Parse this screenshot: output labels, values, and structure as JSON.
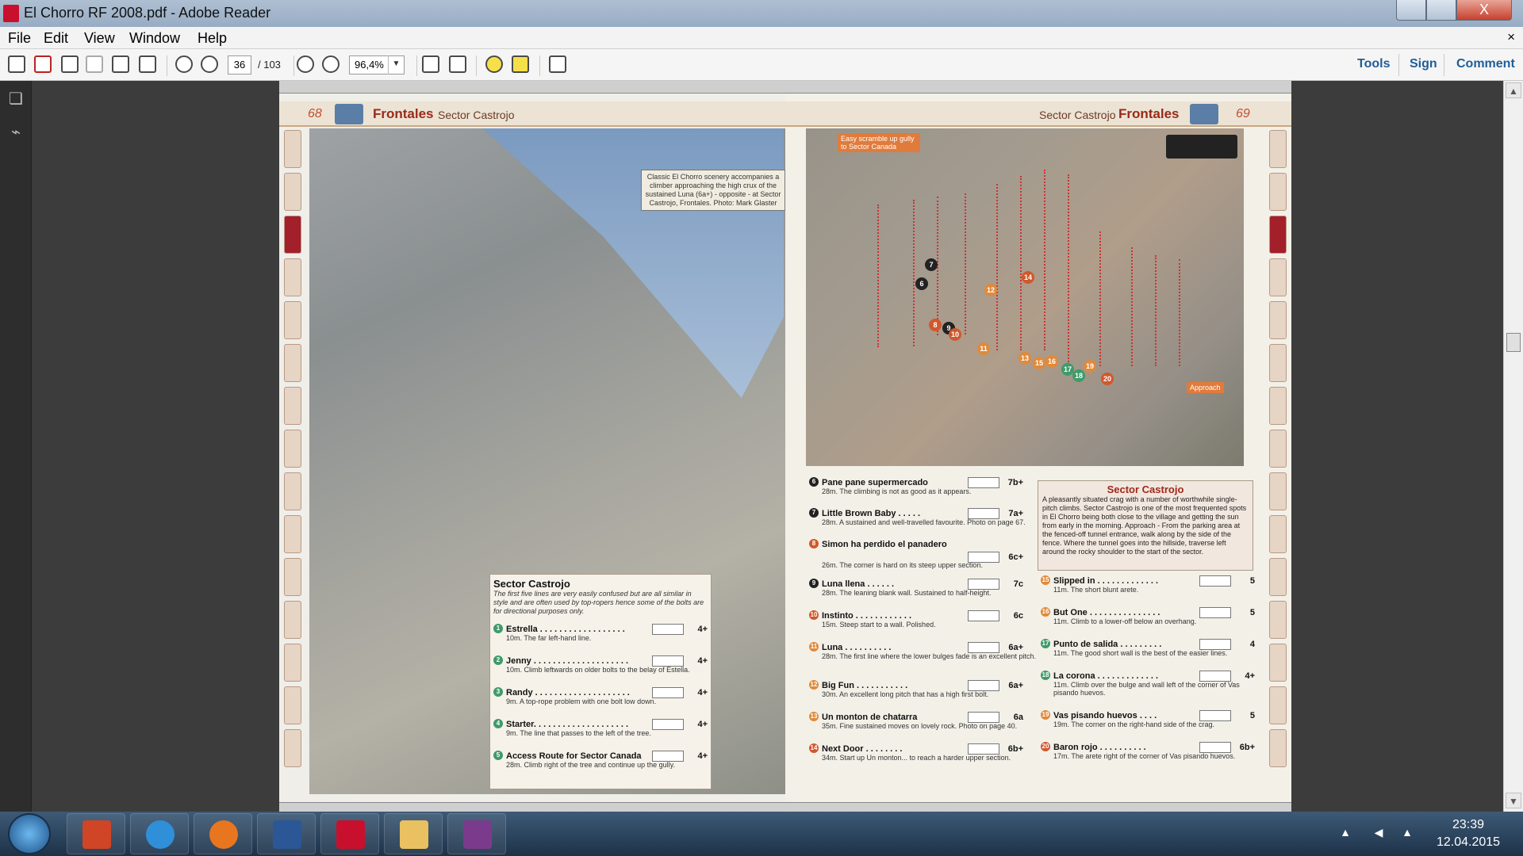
{
  "window": {
    "title": "El Chorro RF 2008.pdf - Adobe Reader",
    "close_glyph": "X"
  },
  "menu": {
    "items": [
      "File",
      "Edit",
      "View",
      "Window",
      "Help"
    ],
    "close_doc": "×"
  },
  "toolbar": {
    "page_current": "36",
    "page_total": "/ 103",
    "zoom": "96,4%",
    "right_links": [
      "Tools",
      "Sign",
      "Comment"
    ],
    "icons": [
      "create-pdf-icon",
      "pdf-icon",
      "edit-icon",
      "save-icon",
      "print-icon",
      "email-icon",
      "page-up-icon",
      "page-down-icon",
      "zoom-out-icon",
      "zoom-in-icon",
      "fit-page-icon",
      "fit-width-icon",
      "comment-icon",
      "highlight-icon",
      "fullscreen-icon"
    ]
  },
  "left_page": {
    "page_number": "68",
    "section": "Frontales",
    "sector": "Sector Castrojo",
    "caption": "Classic El Chorro scenery accompanies a climber approaching the high crux of the sustained Luna (6a+) - opposite - at Sector Castrojo, Frontales. Photo: Mark Glaster",
    "box": {
      "title": "Sector Castrojo",
      "intro": "The first five lines are very easily confused but are all similar in style and are often used by top-ropers hence some of the bolts are for directional purposes only.",
      "routes": [
        {
          "num": "1",
          "name": "Estrella . . . . . . . . . . . . . . . . . .",
          "grade": "4+",
          "desc": "10m. The far left-hand line."
        },
        {
          "num": "2",
          "name": "Jenny . . . . . . . . . . . . . . . . . . . .",
          "grade": "4+",
          "desc": "10m. Climb leftwards on older bolts to the belay of Estella."
        },
        {
          "num": "3",
          "name": "Randy . . . . . . . . . . . . . . . . . . . .",
          "grade": "4+",
          "desc": "9m. A top-rope problem with one bolt low down."
        },
        {
          "num": "4",
          "name": "Starter. . . . . . . . . . . . . . . . . . . .",
          "grade": "4+",
          "desc": "9m. The line that passes to the left of the tree."
        },
        {
          "num": "5",
          "name": "Access Route for Sector Canada",
          "grade": "4+",
          "desc": "28m. Climb right of the tree and continue up the gully."
        }
      ]
    }
  },
  "right_page": {
    "page_number": "69",
    "section": "Frontales",
    "sector": "Sector Castrojo",
    "photo_annotation": "Easy scramble up gully to Sector Canada",
    "approach_label": "Approach",
    "routes_left": [
      {
        "num": "6",
        "name": "Pane pane supermercado",
        "grade": "7b+",
        "desc": "28m. The climbing is not as good as it appears.",
        "color": "#222"
      },
      {
        "num": "7",
        "name": "Little Brown Baby . . . . .",
        "grade": "7a+",
        "desc": "28m. A sustained and well-travelled favourite. Photo on page 67.",
        "color": "#222"
      },
      {
        "num": "8",
        "name": "Simon ha perdido el panadero",
        "grade": "6c+",
        "desc": "26m. The corner is hard on its steep upper section.",
        "color": "#d1582c"
      },
      {
        "num": "9",
        "name": "Luna llena . . . . . .",
        "grade": "7c",
        "desc": "28m. The leaning blank wall. Sustained to half-height.",
        "color": "#222"
      },
      {
        "num": "10",
        "name": "Instinto . . . . . . . . . . . .",
        "grade": "6c",
        "desc": "15m. Steep start to a wall. Polished.",
        "color": "#d1582c"
      },
      {
        "num": "11",
        "name": "Luna . . . . . . . . . .",
        "grade": "6a+",
        "desc": "28m. The first line where the lower bulges fade is an excellent pitch.",
        "color": "#e08a3a"
      },
      {
        "num": "12",
        "name": "Big Fun . . . . . . . . . . .",
        "grade": "6a+",
        "desc": "30m. An excellent long pitch that has a high first bolt.",
        "color": "#e08a3a"
      },
      {
        "num": "13",
        "name": "Un monton de chatarra",
        "grade": "6a",
        "desc": "35m. Fine sustained moves on lovely rock. Photo on page 40.",
        "color": "#e08a3a"
      },
      {
        "num": "14",
        "name": "Next Door . . . . . . . .",
        "grade": "6b+",
        "desc": "34m. Start up Un monton... to reach a harder upper section.",
        "color": "#d1582c"
      }
    ],
    "routes_right": [
      {
        "num": "15",
        "name": "Slipped in . . . . . . . . . . . . .",
        "grade": "5",
        "desc": "11m. The short blunt arete.",
        "color": "#e08a3a"
      },
      {
        "num": "16",
        "name": "But One . . . . . . . . . . . . . . .",
        "grade": "5",
        "desc": "11m. Climb to a lower-off below an overhang.",
        "color": "#e08a3a"
      },
      {
        "num": "17",
        "name": "Punto de salida . . . . . . . . .",
        "grade": "4",
        "desc": "11m. The good short wall is the best of the easier lines.",
        "color": "#3e9b6a"
      },
      {
        "num": "18",
        "name": "La corona . . . . . . . . . . . . .",
        "grade": "4+",
        "desc": "11m. Climb over the bulge and wall left of the corner of Vas pisando huevos.",
        "color": "#3e9b6a"
      },
      {
        "num": "19",
        "name": "Vas pisando huevos . . . .",
        "grade": "5",
        "desc": "19m. The corner on the right-hand side of the crag.",
        "color": "#e08a3a"
      },
      {
        "num": "20",
        "name": "Baron rojo . . . . . . . . . .",
        "grade": "6b+",
        "desc": "17m. The arete right of the corner of Vas pisando huevos.",
        "color": "#d1582c"
      }
    ],
    "blurb": {
      "title": "Sector Castrojo",
      "text": "A pleasantly situated crag with a number of worthwhile single-pitch climbs. Sector Castrojo is one of the most frequented spots in El Chorro being both close to the village and getting the sun from early in the morning. Approach - From the parking area at the fenced-off tunnel entrance, walk along by the side of the fence. Where the tunnel goes into the hillside, traverse left around the rocky shoulder to the start of the sector."
    }
  },
  "taskbar": {
    "apps": [
      "powerpoint-icon",
      "internet-explorer-icon",
      "firefox-icon",
      "word-icon",
      "adobe-reader-icon",
      "file-explorer-icon",
      "winrar-icon"
    ],
    "time": "23:39",
    "date": "12.04.2015"
  }
}
